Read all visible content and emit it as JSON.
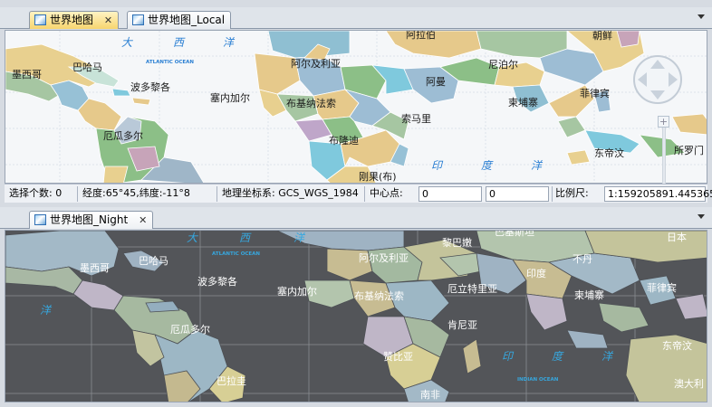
{
  "top_tabs": [
    {
      "label": "世界地图",
      "active": true,
      "closable": true
    },
    {
      "label": "世界地图_Local",
      "active": false,
      "closable": false
    }
  ],
  "bottom_tabs": [
    {
      "label": "世界地图_Night",
      "active": false,
      "closable": true
    }
  ],
  "status_bar": {
    "selected_count": "选择个数:  0",
    "coords": "经度:65°45,纬度:-11°8",
    "crs": "地理坐标系: GCS_WGS_1984",
    "center_label": "中心点:",
    "center_x": "0",
    "center_y": "0",
    "scale_label": "比例尺:",
    "scale_value": "1:159205891.445365"
  },
  "top_map": {
    "oceans": {
      "atlantic_cn_1": "大",
      "atlantic_cn_2": "西",
      "atlantic_cn_3": "洋",
      "atlantic_en": "ATLANTIC OCEAN",
      "indian_cn_1": "印",
      "indian_cn_2": "度",
      "indian_cn_3": "洋"
    },
    "labels": {
      "mexico": "墨西哥",
      "bahamas": "巴哈马",
      "puerto_rico": "波多黎各",
      "ecuador": "厄瓜多尔",
      "algeria": "阿尔及利亚",
      "senegal": "塞内加尔",
      "burkina": "布基纳法索",
      "burundi": "布隆迪",
      "congo": "刚果(布)",
      "arabia": "阿拉伯",
      "oman": "阿曼",
      "somalia": "索马里",
      "nepal": "尼泊尔",
      "cambodia": "柬埔寨",
      "philippines": "菲律宾",
      "korea": "朝鲜",
      "timor": "东帝汶",
      "solomon": "所罗门"
    }
  },
  "bottom_map": {
    "oceans": {
      "atlantic_cn_1": "大",
      "atlantic_cn_2": "西",
      "atlantic_cn_3": "洋",
      "atlantic_en": "ATLANTIC OCEAN",
      "pacific_cn": "洋",
      "indian_cn_1": "印",
      "indian_cn_2": "度",
      "indian_cn_3": "洋",
      "indian_en": "INDIAN OCEAN"
    },
    "labels": {
      "mexico": "墨西哥",
      "bahamas": "巴哈马",
      "puerto_rico": "波多黎各",
      "ecuador": "厄瓜多尔",
      "paraguay": "巴拉圭",
      "algeria": "阿尔及利亚",
      "senegal": "塞内加尔",
      "burkina": "布基纳法索",
      "eritrea": "厄立特里亚",
      "kenya": "肯尼亚",
      "zambia": "赞比亚",
      "south_africa": "南非",
      "lebanon": "黎巴嫩",
      "arabia": "巴基斯坦",
      "india": "印度",
      "bhutan": "不丹",
      "cambodia": "柬埔寨",
      "philippines": "菲律宾",
      "japan": "日本",
      "brunei": "东帝汶",
      "australia": "澳大利"
    }
  }
}
